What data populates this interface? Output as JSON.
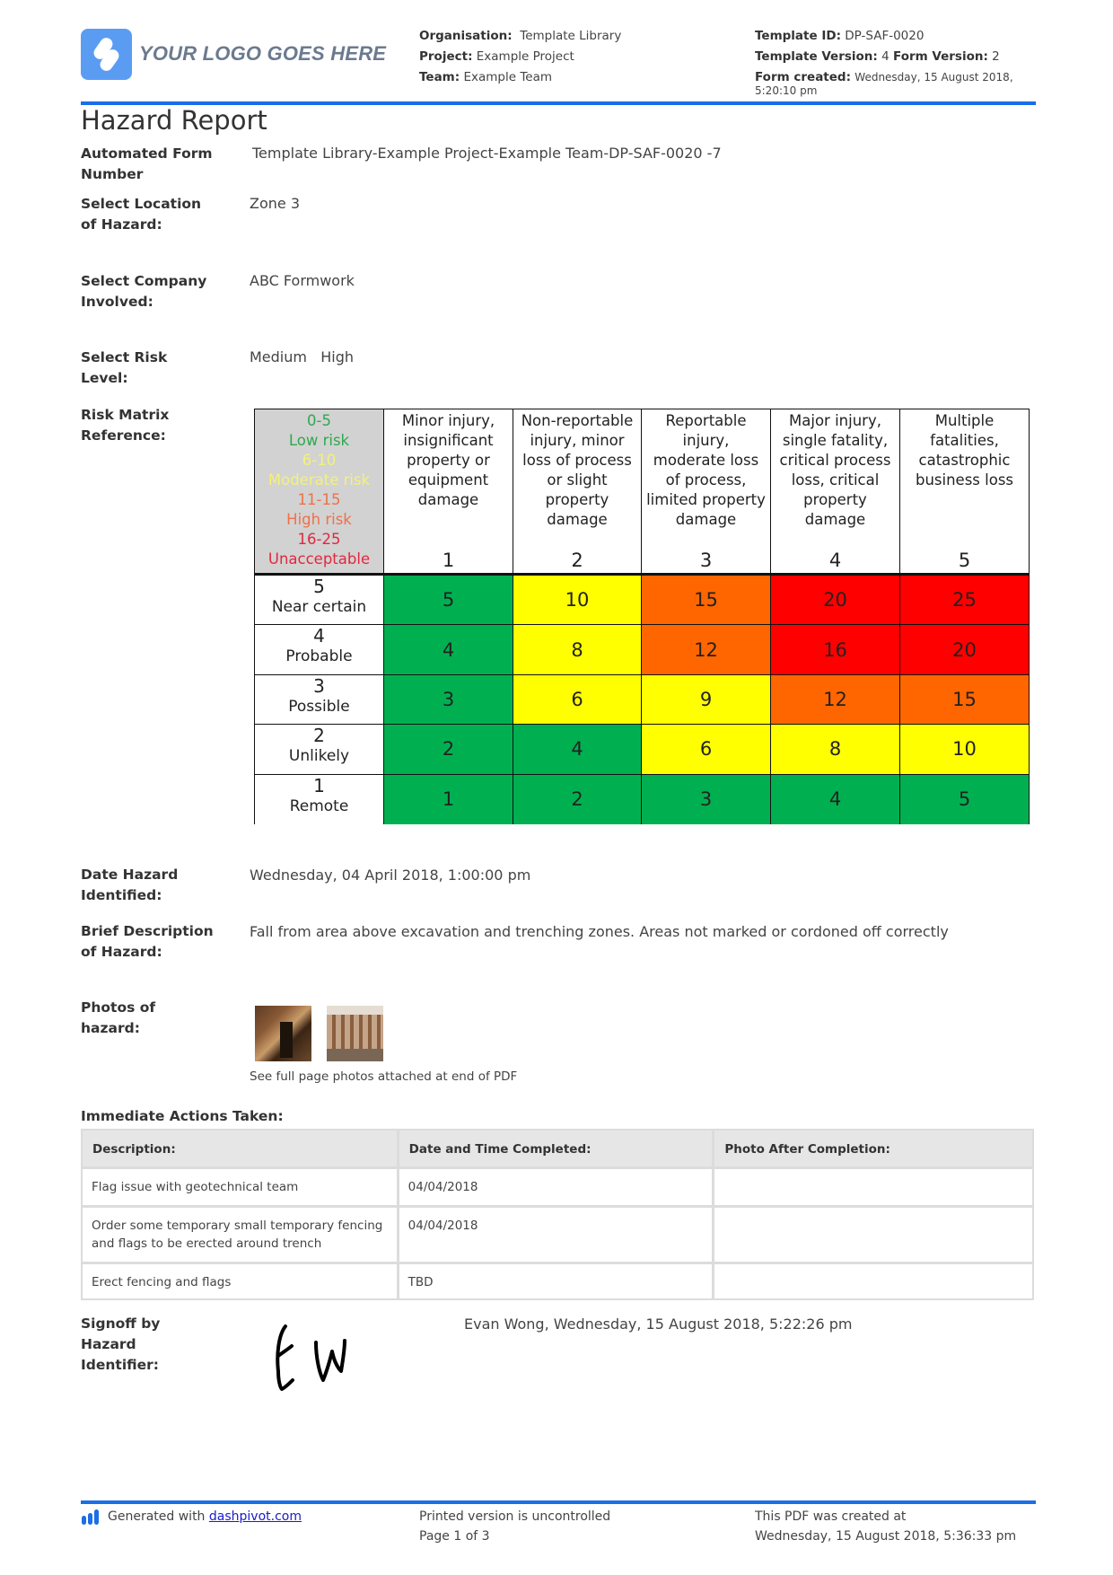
{
  "header": {
    "logo_text": "YOUR LOGO GOES HERE",
    "organisation_label": "Organisation:",
    "organisation_value": "Template Library",
    "project_label": "Project:",
    "project_value": "Example Project",
    "team_label": "Team:",
    "team_value": "Example Team",
    "template_id_label": "Template ID:",
    "template_id_value": "DP-SAF-0020",
    "template_version_label": "Template Version:",
    "template_version_value": "4",
    "form_version_label": "Form Version:",
    "form_version_value": "2",
    "form_created_label": "Form created:",
    "form_created_value": "Wednesday, 15 August 2018,",
    "form_created_time": "5:20:10 pm",
    "accent_color": "#1a6ee6"
  },
  "title": "Hazard Report",
  "fields": {
    "form_number": {
      "label": "Automated Form Number",
      "value": "Template Library-Example Project-Example Team-DP-SAF-0020   -7"
    },
    "location": {
      "label": "Select Location of Hazard:",
      "value": "Zone 3"
    },
    "company": {
      "label": "Select Company Involved:",
      "value": "ABC Formwork"
    },
    "risk_level": {
      "label": "Select Risk Level:",
      "value": "Medium   High"
    },
    "risk_matrix": {
      "label": "Risk Matrix Reference:"
    },
    "date_identified": {
      "label": "Date Hazard Identified:",
      "value": "Wednesday, 04 April 2018, 1:00:00 pm"
    },
    "description": {
      "label": "Brief Description of Hazard:",
      "value": "Fall from area above excavation and trenching zones. Areas not marked or cordoned off correctly"
    },
    "photos": {
      "label": "Photos of hazard:",
      "caption": "See full page photos attached at end of PDF"
    }
  },
  "risk_matrix": {
    "legend": [
      {
        "range": "0-5",
        "label": "Low risk",
        "class": "legend-low"
      },
      {
        "range": "6-10",
        "label": "Moderate risk",
        "class": "legend-mod"
      },
      {
        "range": "11-15",
        "label": "High risk",
        "class": "legend-high"
      },
      {
        "range": "16-25",
        "label": "Unacceptable",
        "class": "legend-unacc"
      }
    ],
    "consequences": [
      {
        "num": "1",
        "desc": "Minor injury, insignificant property or equipment damage"
      },
      {
        "num": "2",
        "desc": "Non-reportable injury, minor loss of process or slight property damage"
      },
      {
        "num": "3",
        "desc": "Reportable injury, moderate loss of process, limited property damage"
      },
      {
        "num": "4",
        "desc": "Major injury, single fatality, critical process loss, critical property damage"
      },
      {
        "num": "5",
        "desc": "Multiple fatalities, catastrophic business loss"
      }
    ],
    "likelihoods": [
      {
        "num": "5",
        "label": "Near certain",
        "scores": [
          "5",
          "10",
          "15",
          "20",
          "25"
        ],
        "levels": [
          "low",
          "mod",
          "high",
          "unacc",
          "unacc"
        ]
      },
      {
        "num": "4",
        "label": "Probable",
        "scores": [
          "4",
          "8",
          "12",
          "16",
          "20"
        ],
        "levels": [
          "low",
          "mod",
          "high",
          "unacc",
          "unacc"
        ]
      },
      {
        "num": "3",
        "label": "Possible",
        "scores": [
          "3",
          "6",
          "9",
          "12",
          "15"
        ],
        "levels": [
          "low",
          "mod",
          "mod",
          "high",
          "high"
        ]
      },
      {
        "num": "2",
        "label": "Unlikely",
        "scores": [
          "2",
          "4",
          "6",
          "8",
          "10"
        ],
        "levels": [
          "low",
          "low",
          "mod",
          "mod",
          "mod"
        ]
      },
      {
        "num": "1",
        "label": "Remote",
        "scores": [
          "1",
          "2",
          "3",
          "4",
          "5"
        ],
        "levels": [
          "low",
          "low",
          "low",
          "low",
          "low"
        ]
      }
    ],
    "colors": {
      "low": "#00b050",
      "mod": "#ffff00",
      "high": "#ff6600",
      "unacc": "#ff0000",
      "legend_bg": "#d2d2d2"
    }
  },
  "actions": {
    "heading": "Immediate Actions Taken:",
    "columns": [
      "Description:",
      "Date and Time Completed:",
      "Photo After Completion:"
    ],
    "rows": [
      {
        "description": "Flag issue with geotechnical team",
        "date": "04/04/2018",
        "photo": ""
      },
      {
        "description": "Order some temporary small temporary fencing and flags to be erected around trench",
        "date": "04/04/2018",
        "photo": ""
      },
      {
        "description": "Erect fencing and flags",
        "date": "TBD",
        "photo": ""
      }
    ]
  },
  "signoff": {
    "label": "Signoff by Hazard Identifier:",
    "signature_initials": "EW",
    "value": "Evan Wong, Wednesday, 15 August 2018, 5:22:26 pm"
  },
  "footer": {
    "generated_prefix": "Generated with",
    "generated_link": "dashpivot.com",
    "uncontrolled": "Printed version is uncontrolled",
    "page": "Page 1 of 3",
    "pdf_created_label": "This PDF was created at",
    "pdf_created_value": "Wednesday, 15 August 2018, 5:36:33 pm"
  }
}
